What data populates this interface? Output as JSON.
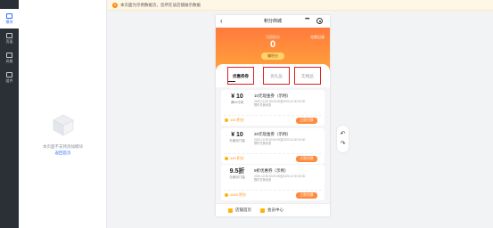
{
  "rail": {
    "items": [
      {
        "label": "模块",
        "active": true
      },
      {
        "label": "页面",
        "active": false
      },
      {
        "label": "风格",
        "active": false
      },
      {
        "label": "组件",
        "active": false
      }
    ]
  },
  "panel": {
    "empty_text": "本页面不支持添加模块",
    "link_text": "返回首页"
  },
  "notice": {
    "text": "本页面为示例数据页，您所在该店铺展示数据"
  },
  "phone": {
    "nav": {
      "back_icon": "‹",
      "title": "积分商城",
      "more_icon": "•••"
    },
    "hero": {
      "label": "可用积分",
      "value": "0",
      "record_label": "兑换记录",
      "earn_button": "赚积分"
    },
    "tabs": [
      {
        "label": "优惠券券",
        "active": true
      },
      {
        "label": "优礼品",
        "active": false
      },
      {
        "label": "实物品",
        "active": false
      }
    ],
    "cards": [
      {
        "amount": "¥ 10",
        "condition": "满60可用",
        "name": "10元现金券（示例）",
        "date1": "2020.12.08 00:00:00至2020.12.00 00:00",
        "date2": "限时兑换优惠",
        "price": "100 积分",
        "button": "立即兑换"
      },
      {
        "amount": "¥ 10",
        "condition": "无使用门槛",
        "name": "20元现金券（示例）",
        "date1": "2020.12.08 00:00:00至2020.12.00 00:00",
        "date2": "限时兑换优惠",
        "price": "100 积分",
        "button": "立即兑换"
      },
      {
        "amount": "9.5折",
        "condition": "无使用门槛",
        "name": "9折优惠券（示例）",
        "date1": "2020.12.08 00:00:00至2020.12.00 00:00",
        "date2": "限时兑换优惠",
        "price": "1000 积分",
        "button": "立即兑换"
      }
    ],
    "bottom": {
      "home": "店铺首页",
      "member": "会员中心"
    }
  },
  "tool": {
    "undo": "↶",
    "redo": "↷"
  },
  "colors": {
    "accent": "#2f6bff",
    "hero_start": "#ff7a3c",
    "hero_end": "#ffb347",
    "highlight_border": "#e02020",
    "exchange_button": "#ff8a3c"
  }
}
